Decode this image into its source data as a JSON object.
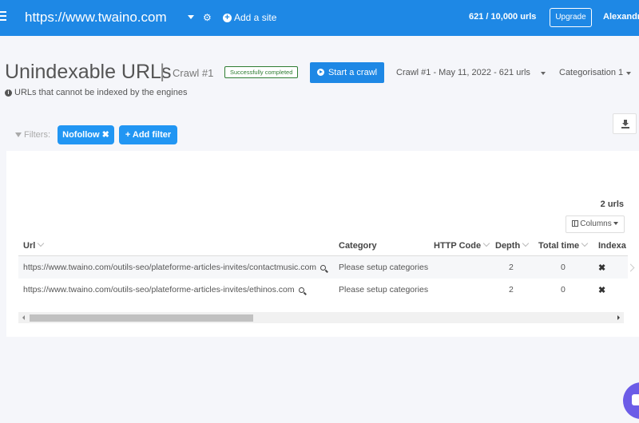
{
  "topbar": {
    "site_url": "https://www.twaino.com",
    "add_site_label": "Add a site",
    "quota": "621 / 10,000 urls",
    "upgrade_label": "Upgrade",
    "username": "Alexandr"
  },
  "header": {
    "title": "Unindexable URLs",
    "separator": "|",
    "crawl_label": "Crawl #1",
    "status": "Successfully completed",
    "start_crawl_label": "Start a crawl",
    "crawl_select": "Crawl #1 - May 11, 2022 - 621 urls",
    "categorisation": "Categorisation 1",
    "subtitle": "URLs that cannot be indexed by the engines"
  },
  "filters": {
    "label": "Filters:",
    "active": [
      {
        "label": "Nofollow ✖"
      }
    ],
    "add_filter_label": "Add filter"
  },
  "table": {
    "count": "2 urls",
    "columns_label": "Columns",
    "headers": {
      "url": "Url",
      "category": "Category",
      "http_code": "HTTP Code",
      "depth": "Depth",
      "total_time": "Total time",
      "indexable": "Indexa"
    },
    "rows": [
      {
        "url": "https://www.twaino.com/outils-seo/plateforme-articles-invites/contactmusic.com",
        "category": "Please setup categories",
        "http_code": "",
        "depth": "2",
        "total_time": "0",
        "indexable": "✖"
      },
      {
        "url": "https://www.twaino.com/outils-seo/plateforme-articles-invites/ethinos.com",
        "category": "Please setup categories",
        "http_code": "",
        "depth": "2",
        "total_time": "0",
        "indexable": "✖"
      }
    ]
  },
  "colors": {
    "topbar": "#1e88e5",
    "primary_button": "#2196f3",
    "status_green": "#2e7d32",
    "chat_purple": "#6c5ce7"
  }
}
